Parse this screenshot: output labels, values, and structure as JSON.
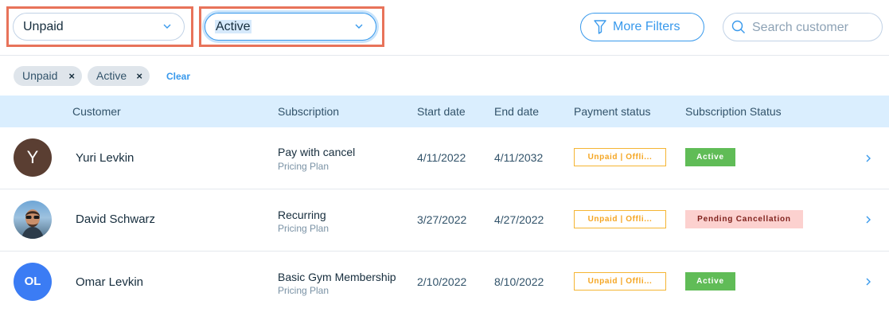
{
  "filters": {
    "payment_dropdown": "Unpaid",
    "status_dropdown": "Active",
    "more_filters_label": "More Filters",
    "search_placeholder": "Search customer"
  },
  "chips": [
    {
      "label": "Unpaid",
      "remove": "×"
    },
    {
      "label": "Active",
      "remove": "×"
    }
  ],
  "clear_label": "Clear",
  "columns": [
    "Customer",
    "Subscription",
    "Start date",
    "End date",
    "Payment status",
    "Subscription Status"
  ],
  "rows": [
    {
      "avatar_initials": "Y",
      "name": "Yuri Levkin",
      "subscription": "Pay with cancel",
      "plan_type": "Pricing Plan",
      "start": "4/11/2022",
      "end": "4/11/2032",
      "payment_status": "Unpaid | Offli...",
      "subscription_status": "Active"
    },
    {
      "avatar_initials": "",
      "name": "David Schwarz",
      "subscription": "Recurring",
      "plan_type": "Pricing Plan",
      "start": "3/27/2022",
      "end": "4/27/2022",
      "payment_status": "Unpaid | Offli...",
      "subscription_status": "Pending Cancellation"
    },
    {
      "avatar_initials": "OL",
      "name": "Omar Levkin",
      "subscription": "Basic Gym Membership",
      "plan_type": "Pricing Plan",
      "start": "2/10/2022",
      "end": "8/10/2022",
      "payment_status": "Unpaid | Offli...",
      "subscription_status": "Active"
    }
  ],
  "colors": {
    "accent": "#3899ec",
    "highlight_border": "#e8735a",
    "header_bg": "#daeefe",
    "active_badge": "#60bc57",
    "pending_badge": "#fcd1cf",
    "unpaid_border": "#f5b533"
  }
}
